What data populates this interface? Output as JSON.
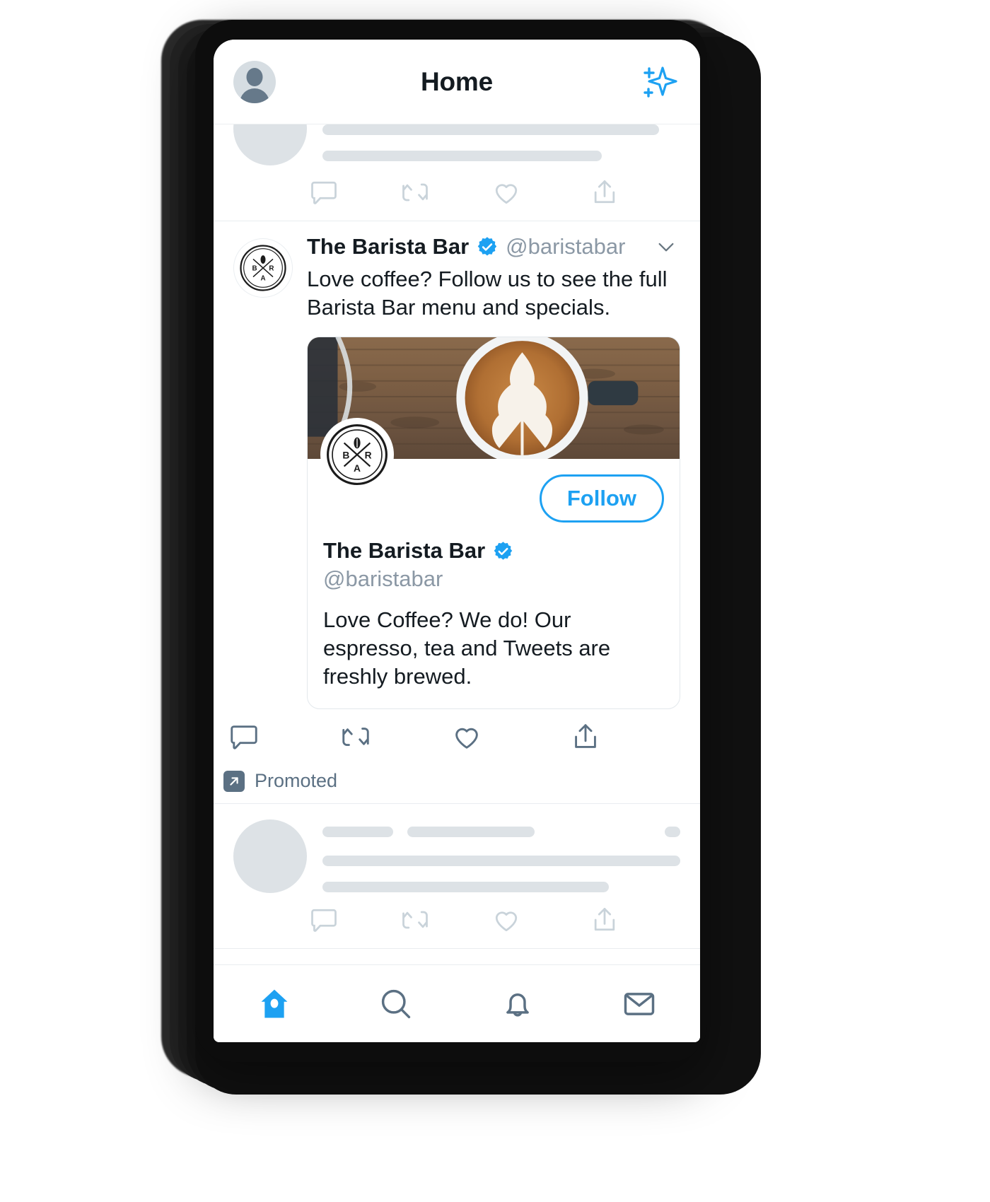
{
  "app": {
    "title": "Home",
    "accent_color": "#1da1f2",
    "text_color": "#141b21",
    "muted_color": "#8b98a5",
    "skeleton_color": "#dde2e6"
  },
  "topbar": {
    "title": "Home",
    "avatar_name": "profile-avatar",
    "sparkle_icon": "sparkle-icon"
  },
  "promoted_tweet": {
    "display_name": "The Barista Bar",
    "handle": "@baristabar",
    "verified": true,
    "text": "Love coffee? Follow us to see the full Barista Bar menu and specials.",
    "chevron_icon": "chevron-down-icon",
    "media_alt": "latte-art-coffee-cup-on-wood-table",
    "promoted_label": "Promoted",
    "promoted_icon": "arrow-up-right-icon",
    "card": {
      "display_name": "The Barista Bar",
      "handle": "@baristabar",
      "verified": true,
      "bio": "Love Coffee? We do! Our espresso, tea and Tweets are freshly brewed.",
      "follow_label": "Follow",
      "logo_letters": {
        "left": "B",
        "right": "R",
        "bottom": "A"
      }
    },
    "actions": [
      {
        "name": "reply-icon",
        "label": "Reply"
      },
      {
        "name": "retweet-icon",
        "label": "Retweet"
      },
      {
        "name": "like-icon",
        "label": "Like"
      },
      {
        "name": "share-icon",
        "label": "Share"
      }
    ]
  },
  "skeleton_tweets": [
    {
      "name": "skeleton-tweet-top"
    },
    {
      "name": "skeleton-tweet-1"
    },
    {
      "name": "skeleton-tweet-2"
    }
  ],
  "tabbar": {
    "items": [
      {
        "name": "tab-home",
        "icon": "home-icon",
        "label": "Home",
        "active": true
      },
      {
        "name": "tab-search",
        "icon": "search-icon",
        "label": "Search",
        "active": false
      },
      {
        "name": "tab-notifications",
        "icon": "bell-icon",
        "label": "Notifications",
        "active": false
      },
      {
        "name": "tab-messages",
        "icon": "envelope-icon",
        "label": "Messages",
        "active": false
      }
    ]
  }
}
